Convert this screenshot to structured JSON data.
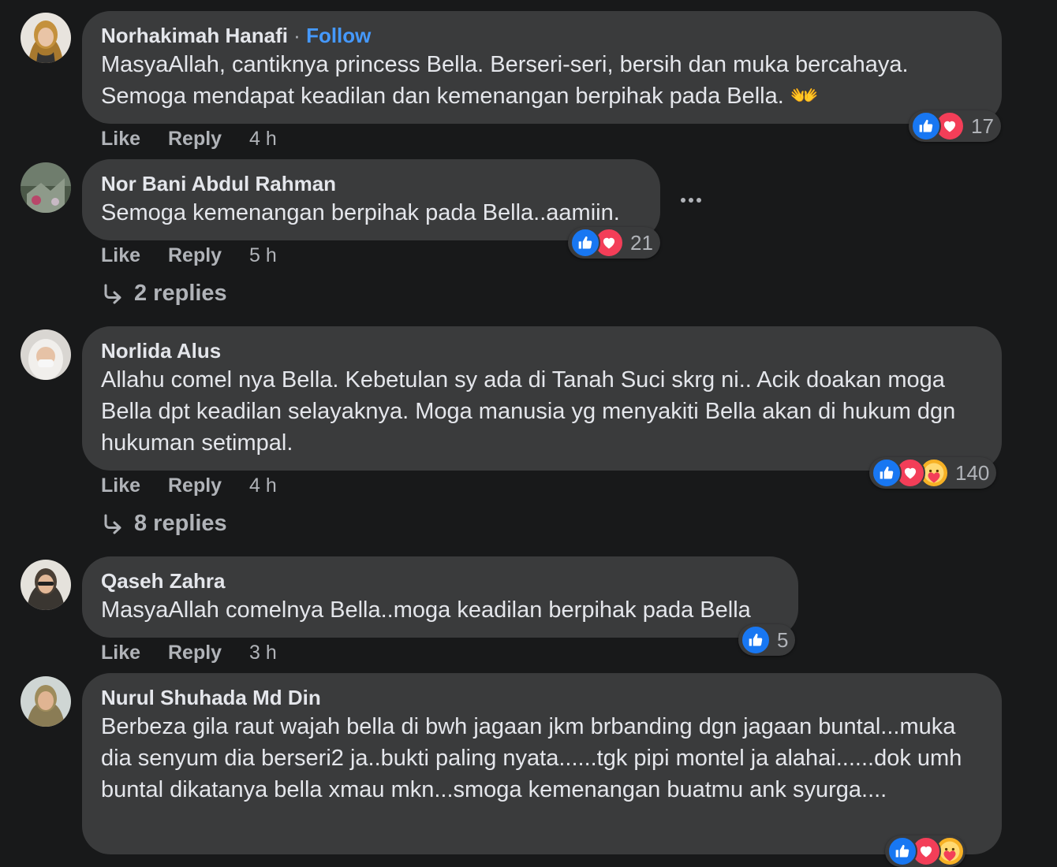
{
  "comments": [
    {
      "author": "Norhakimah Hanafi",
      "follow_separator": " · ",
      "follow": "Follow",
      "text": "MasyaAllah, cantiknya princess Bella. Berseri-seri, bersih dan muka bercahaya. Semoga mendapat keadilan dan kemenangan berpihak pada Bella. 👐",
      "like": "Like",
      "reply": "Reply",
      "time": "4 h",
      "reaction_icons": [
        "like-icon",
        "love-icon"
      ],
      "reaction_count": "17"
    },
    {
      "author": "Nor Bani Abdul Rahman",
      "text": "Semoga kemenangan berpihak pada Bella..aamiin.",
      "like": "Like",
      "reply": "Reply",
      "time": "5 h",
      "reaction_icons": [
        "like-icon",
        "love-icon"
      ],
      "reaction_count": "21",
      "replies_label": "2 replies"
    },
    {
      "author": "Norlida Alus",
      "text": "Allahu comel nya Bella. Kebetulan sy ada di Tanah Suci skrg ni.. Acik doakan moga Bella dpt keadilan selayaknya. Moga manusia yg menyakiti Bella akan di hukum dgn hukuman setimpal.",
      "like": "Like",
      "reply": "Reply",
      "time": "4 h",
      "reaction_icons": [
        "like-icon",
        "love-icon",
        "care-icon"
      ],
      "reaction_count": "140",
      "replies_label": "8 replies"
    },
    {
      "author": "Qaseh Zahra",
      "text": "MasyaAllah comelnya Bella..moga keadilan berpihak pada Bella",
      "like": "Like",
      "reply": "Reply",
      "time": "3 h",
      "reaction_icons": [
        "like-icon"
      ],
      "reaction_count": "5"
    },
    {
      "author": "Nurul Shuhada Md Din",
      "text": "Berbeza gila raut wajah bella di bwh jagaan jkm brbanding dgn jagaan buntal...muka dia senyum dia berseri2 ja..bukti paling nyata......tgk pipi montel ja alahai......dok umh buntal dikatanya bella xmau mkn...smoga kemenangan buatmu ank syurga....",
      "reaction_icons": [
        "like-icon",
        "love-icon",
        "care-icon"
      ]
    }
  ],
  "colors": {
    "background": "#18191a",
    "bubble": "#3a3b3c",
    "text_primary": "#e4e6eb",
    "text_secondary": "#b0b3b8",
    "link": "#4599ff",
    "like_reaction": "#1877f2",
    "love_reaction": "#f33e58",
    "care_reaction": "#f7b125"
  }
}
